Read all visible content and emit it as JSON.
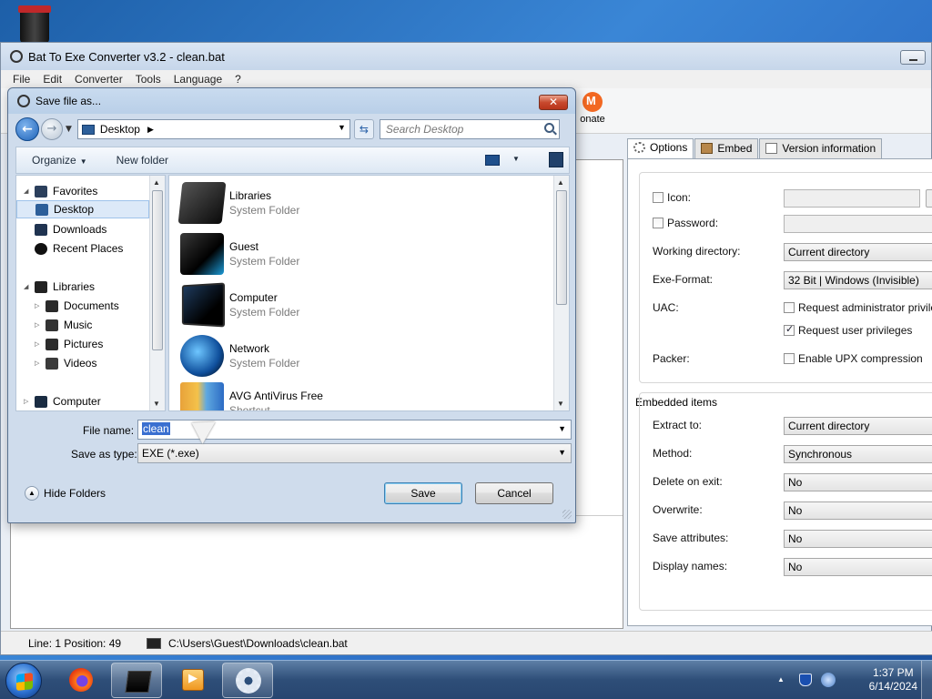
{
  "main_window": {
    "title": "Bat To Exe Converter v3.2 - clean.bat",
    "menu": [
      "File",
      "Edit",
      "Converter",
      "Tools",
      "Language",
      "?"
    ],
    "donate_label": "onate"
  },
  "options_tabs": [
    {
      "label": "Options",
      "icon": "gear-icon"
    },
    {
      "label": "Embed",
      "icon": "box-icon"
    },
    {
      "label": "Version information",
      "icon": "page-icon"
    }
  ],
  "options": {
    "icon_label": "Icon:",
    "password_label": "Password:",
    "working_dir_label": "Working directory:",
    "working_dir_value": "Current directory",
    "exe_format_label": "Exe-Format:",
    "exe_format_value": "32 Bit | Windows (Invisible)",
    "uac_label": "UAC:",
    "uac_admin_label": "Request administrator privileges",
    "uac_admin_checked": false,
    "uac_user_label": "Request user privileges",
    "uac_user_checked": true,
    "packer_label": "Packer:",
    "upx_label": "Enable UPX compression",
    "upx_checked": false,
    "embedded_title": "Embedded items",
    "extract_label": "Extract to:",
    "extract_value": "Current directory",
    "method_label": "Method:",
    "method_value": "Synchronous",
    "delete_label": "Delete on exit:",
    "delete_value": "No",
    "overwrite_label": "Overwrite:",
    "overwrite_value": "No",
    "save_attr_label": "Save attributes:",
    "save_attr_value": "No",
    "display_names_label": "Display names:",
    "display_names_value": "No"
  },
  "statusbar": {
    "position": "Line: 1  Position: 49",
    "path": "C:\\Users\\Guest\\Downloads\\clean.bat"
  },
  "dialog": {
    "title": "Save file as...",
    "close_label": "✕",
    "address": "Desktop",
    "search_placeholder": "Search Desktop",
    "organize_label": "Organize",
    "new_folder_label": "New folder",
    "nav_tree": [
      {
        "label": "Favorites",
        "icon": "star-icon"
      },
      {
        "label": "Desktop",
        "icon": "desktop-icon"
      },
      {
        "label": "Downloads",
        "icon": "downloads-icon"
      },
      {
        "label": "Recent Places",
        "icon": "recent-places-icon"
      },
      {
        "label": "Libraries",
        "icon": "libraries-icon"
      },
      {
        "label": "Documents",
        "icon": "documents-icon"
      },
      {
        "label": "Music",
        "icon": "music-icon"
      },
      {
        "label": "Pictures",
        "icon": "pictures-icon"
      },
      {
        "label": "Videos",
        "icon": "videos-icon"
      },
      {
        "label": "Computer",
        "icon": "computer-icon"
      }
    ],
    "files": [
      {
        "name": "Libraries",
        "type": "System Folder",
        "icon": "libraries-icon"
      },
      {
        "name": "Guest",
        "type": "System Folder",
        "icon": "user-folder-icon"
      },
      {
        "name": "Computer",
        "type": "System Folder",
        "icon": "computer-icon"
      },
      {
        "name": "Network",
        "type": "System Folder",
        "icon": "network-icon"
      },
      {
        "name": "AVG AntiVirus Free",
        "type": "Shortcut",
        "icon": "avg-icon"
      }
    ],
    "file_name_label": "File name:",
    "file_name_value": "clean",
    "save_type_label": "Save as type:",
    "save_type_value": "EXE (*.exe)",
    "hide_folders_label": "Hide Folders",
    "save_label": "Save",
    "cancel_label": "Cancel"
  },
  "taskbar": {
    "clock_time": "1:37 PM",
    "clock_date": "6/14/2024"
  },
  "colors": {
    "selection_blue": "#3a6fd0",
    "close_red": "#c84a2e"
  }
}
